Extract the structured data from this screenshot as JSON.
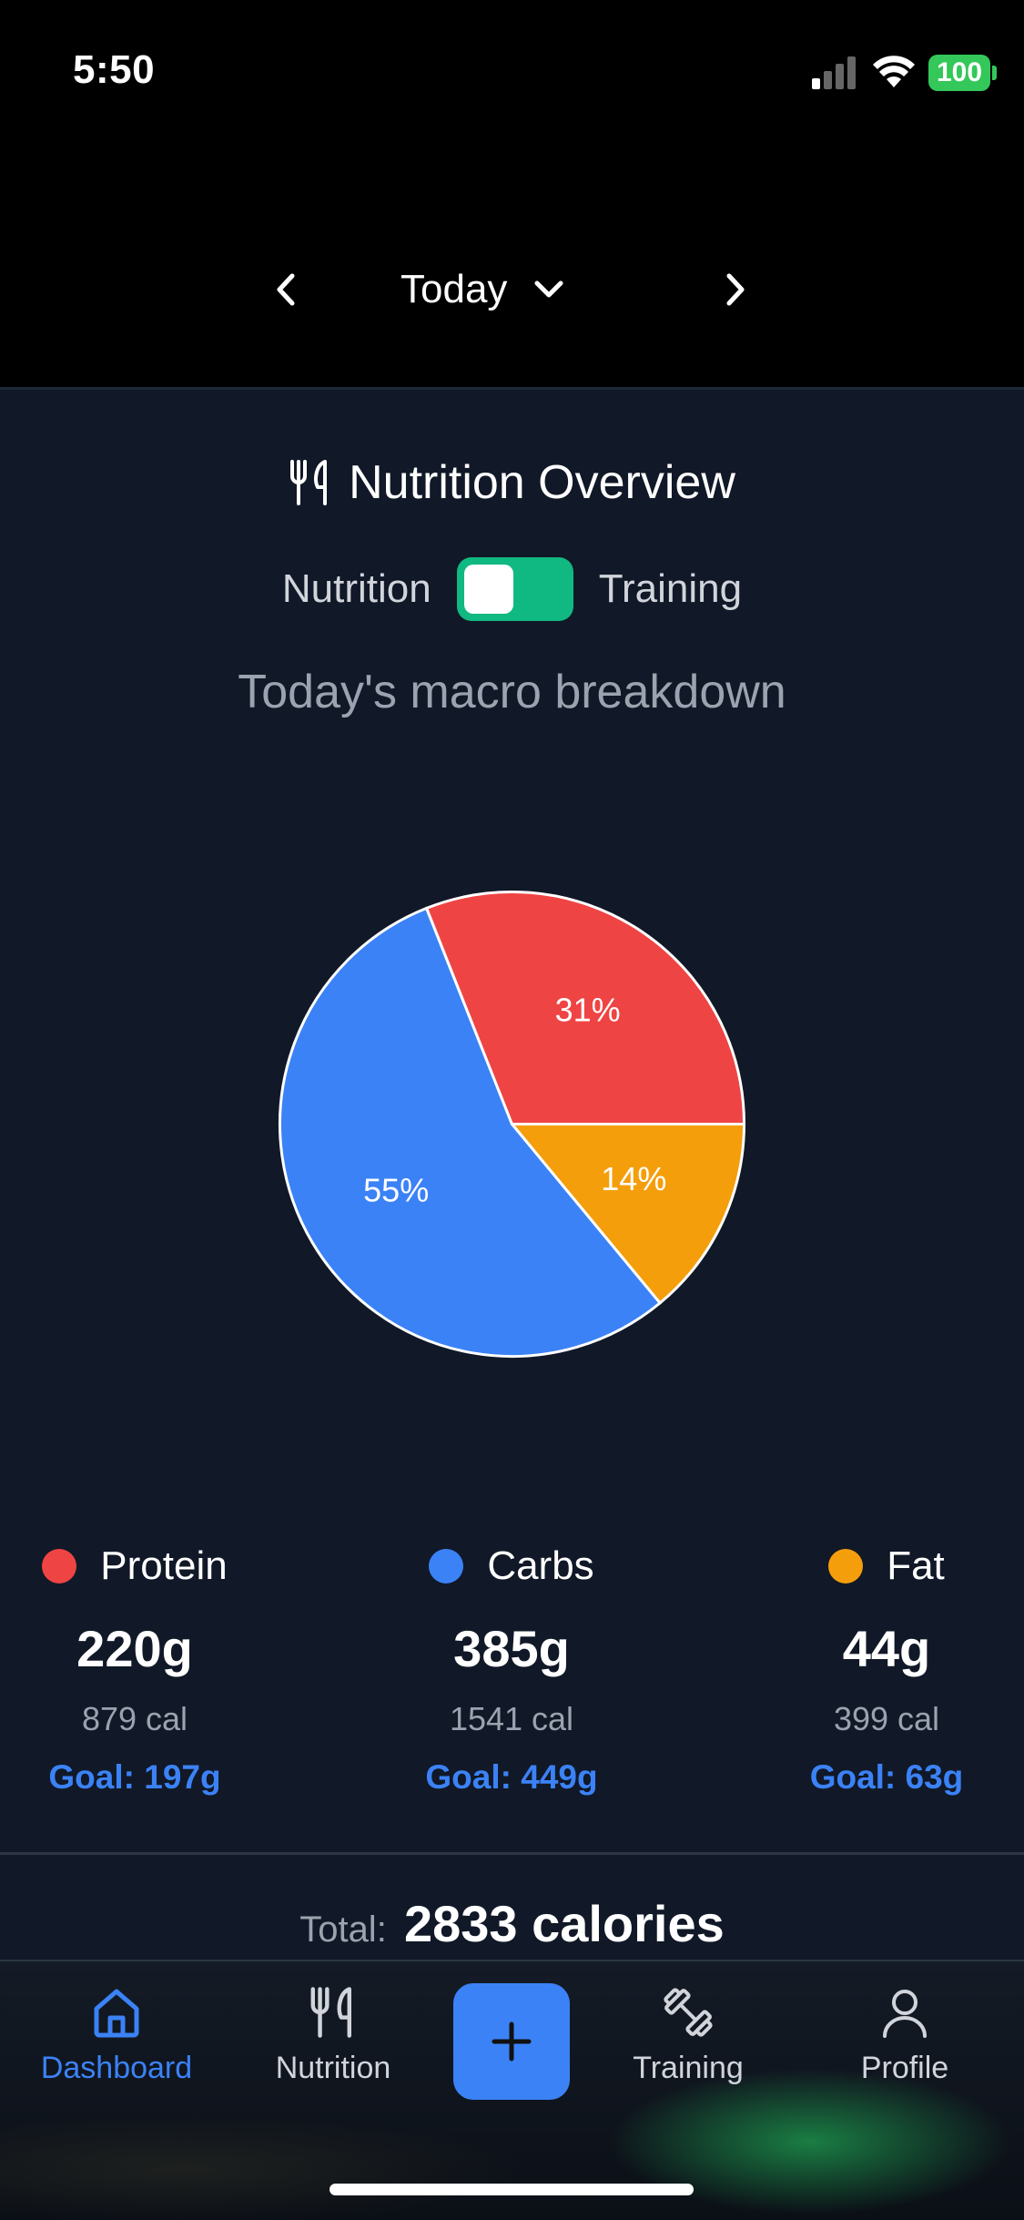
{
  "status": {
    "time": "5:50",
    "battery": "100"
  },
  "header": {
    "date_label": "Today"
  },
  "overview": {
    "title": "Nutrition Overview",
    "toggle_left": "Nutrition",
    "toggle_right": "Training",
    "subtitle": "Today's macro breakdown"
  },
  "chart_data": {
    "type": "pie",
    "categories": [
      "Protein",
      "Carbs",
      "Fat"
    ],
    "values": [
      31,
      55,
      14
    ],
    "labels": [
      "31%",
      "55%",
      "14%"
    ],
    "colors": [
      "#ef4444",
      "#3b82f6",
      "#f59e0b"
    ]
  },
  "macros": [
    {
      "name": "Protein",
      "color": "#ef4444",
      "grams": "220g",
      "calories": "879 cal",
      "goal": "Goal: 197g"
    },
    {
      "name": "Carbs",
      "color": "#3b82f6",
      "grams": "385g",
      "calories": "1541 cal",
      "goal": "Goal: 449g"
    },
    {
      "name": "Fat",
      "color": "#f59e0b",
      "grams": "44g",
      "calories": "399 cal",
      "goal": "Goal: 63g"
    }
  ],
  "total": {
    "prefix": "Total:",
    "value": "2833 calories"
  },
  "tabs": {
    "dashboard": "Dashboard",
    "nutrition": "Nutrition",
    "training": "Training",
    "profile": "Profile"
  }
}
